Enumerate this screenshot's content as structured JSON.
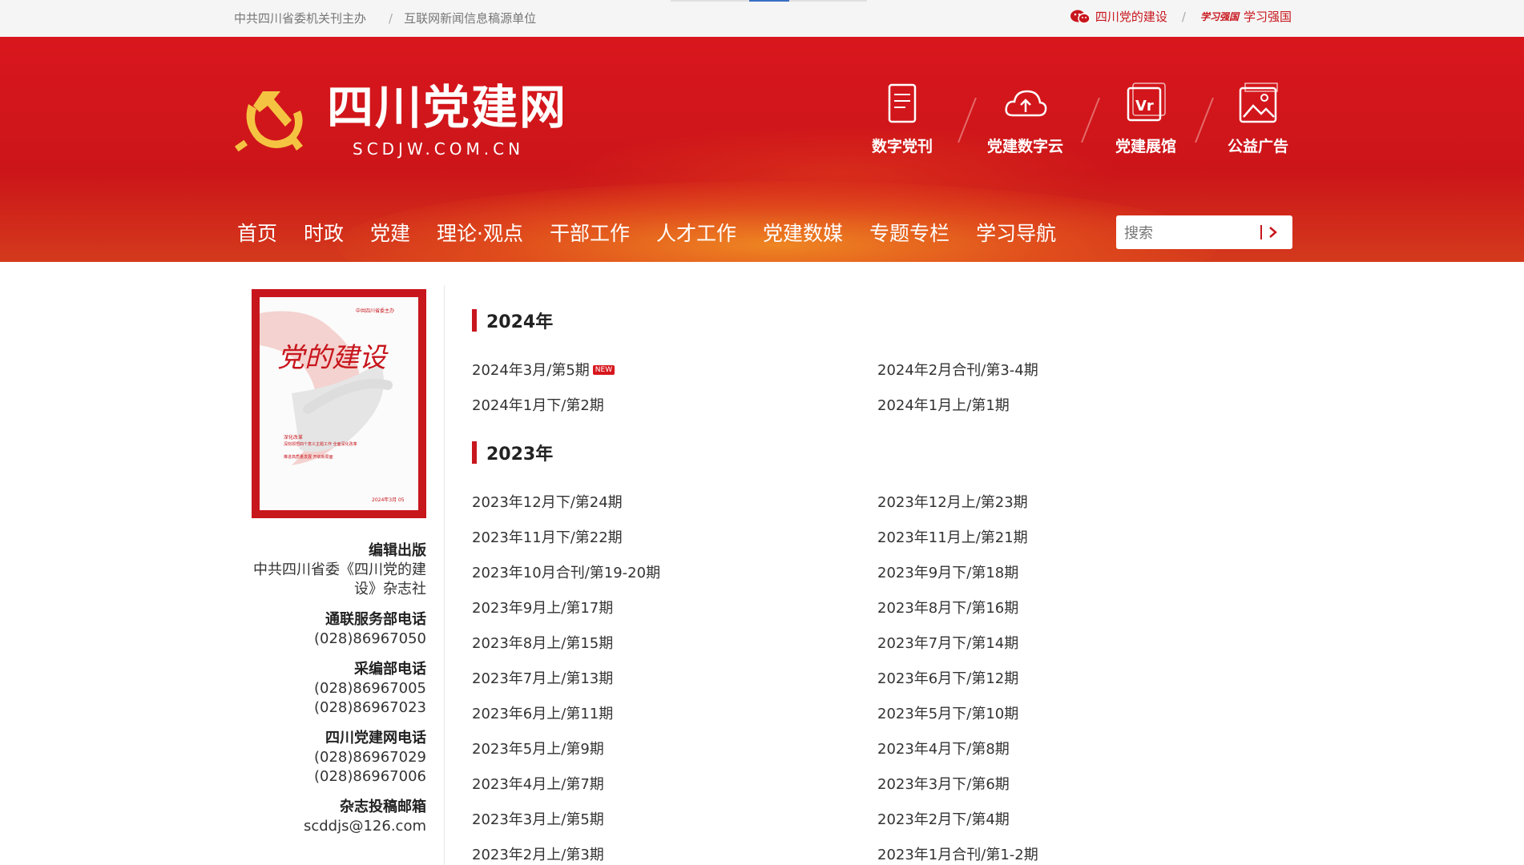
{
  "topbar": {
    "left_items": [
      "中共四川省委机关刊主办",
      "互联网新闻信息稿源单位"
    ],
    "link_party": "四川党的建设",
    "link_xuexi": "学习强国",
    "xuexi_logo_text": "学习强国"
  },
  "header": {
    "site_name": "四川党建网",
    "domain": "SCDJW.COM.CN",
    "quick_links": [
      "数字党刊",
      "党建数字云",
      "党建展馆",
      "公益广告"
    ]
  },
  "nav": {
    "items": [
      "首页",
      "时政",
      "党建",
      "理论·观点",
      "干部工作",
      "人才工作",
      "党建数媒",
      "专题专栏",
      "学习导航"
    ]
  },
  "search": {
    "placeholder": "搜索"
  },
  "cover": {
    "title": "党的建设",
    "top_text": "中共四川省委主办",
    "caption1": "深化改革",
    "caption2": "深刻领悟四个意义主题工作 全面深化改革",
    "caption3": "推进高质量发展 开启新局面",
    "issue_text": "2024年3月 05"
  },
  "sidebar": {
    "blocks": [
      {
        "title": "编辑出版",
        "lines": [
          "中共四川省委《四川党的建",
          "设》杂志社"
        ]
      },
      {
        "title": "通联服务部电话",
        "lines": [
          "(028)86967050"
        ]
      },
      {
        "title": "采编部电话",
        "lines": [
          "(028)86967005",
          "(028)86967023"
        ]
      },
      {
        "title": "四川党建网电话",
        "lines": [
          "(028)86967029",
          "(028)86967006"
        ]
      },
      {
        "title": "杂志投稿邮箱",
        "lines": [
          "scddjs@126.com"
        ]
      }
    ]
  },
  "archive": {
    "new_badge": "NEW",
    "years": [
      {
        "year": "2024年",
        "issues": [
          "2024年3月/第5期",
          "2024年2月合刊/第3-4期",
          "2024年1月下/第2期",
          "2024年1月上/第1期"
        ]
      },
      {
        "year": "2023年",
        "issues": [
          "2023年12月下/第24期",
          "2023年12月上/第23期",
          "2023年11月下/第22期",
          "2023年11月上/第21期",
          "2023年10月合刊/第19-20期",
          "2023年9月下/第18期",
          "2023年9月上/第17期",
          "2023年8月下/第16期",
          "2023年8月上/第15期",
          "2023年7月下/第14期",
          "2023年7月上/第13期",
          "2023年6月下/第12期",
          "2023年6月上/第11期",
          "2023年5月下/第10期",
          "2023年5月上/第9期",
          "2023年4月下/第8期",
          "2023年4月上/第7期",
          "2023年3月下/第6期",
          "2023年3月上/第5期",
          "2023年2月下/第4期",
          "2023年2月上/第3期",
          "2023年1月合刊/第1-2期"
        ]
      }
    ]
  },
  "colors": {
    "brand_red": "#c8161d",
    "accent_gold": "#f5c342"
  }
}
